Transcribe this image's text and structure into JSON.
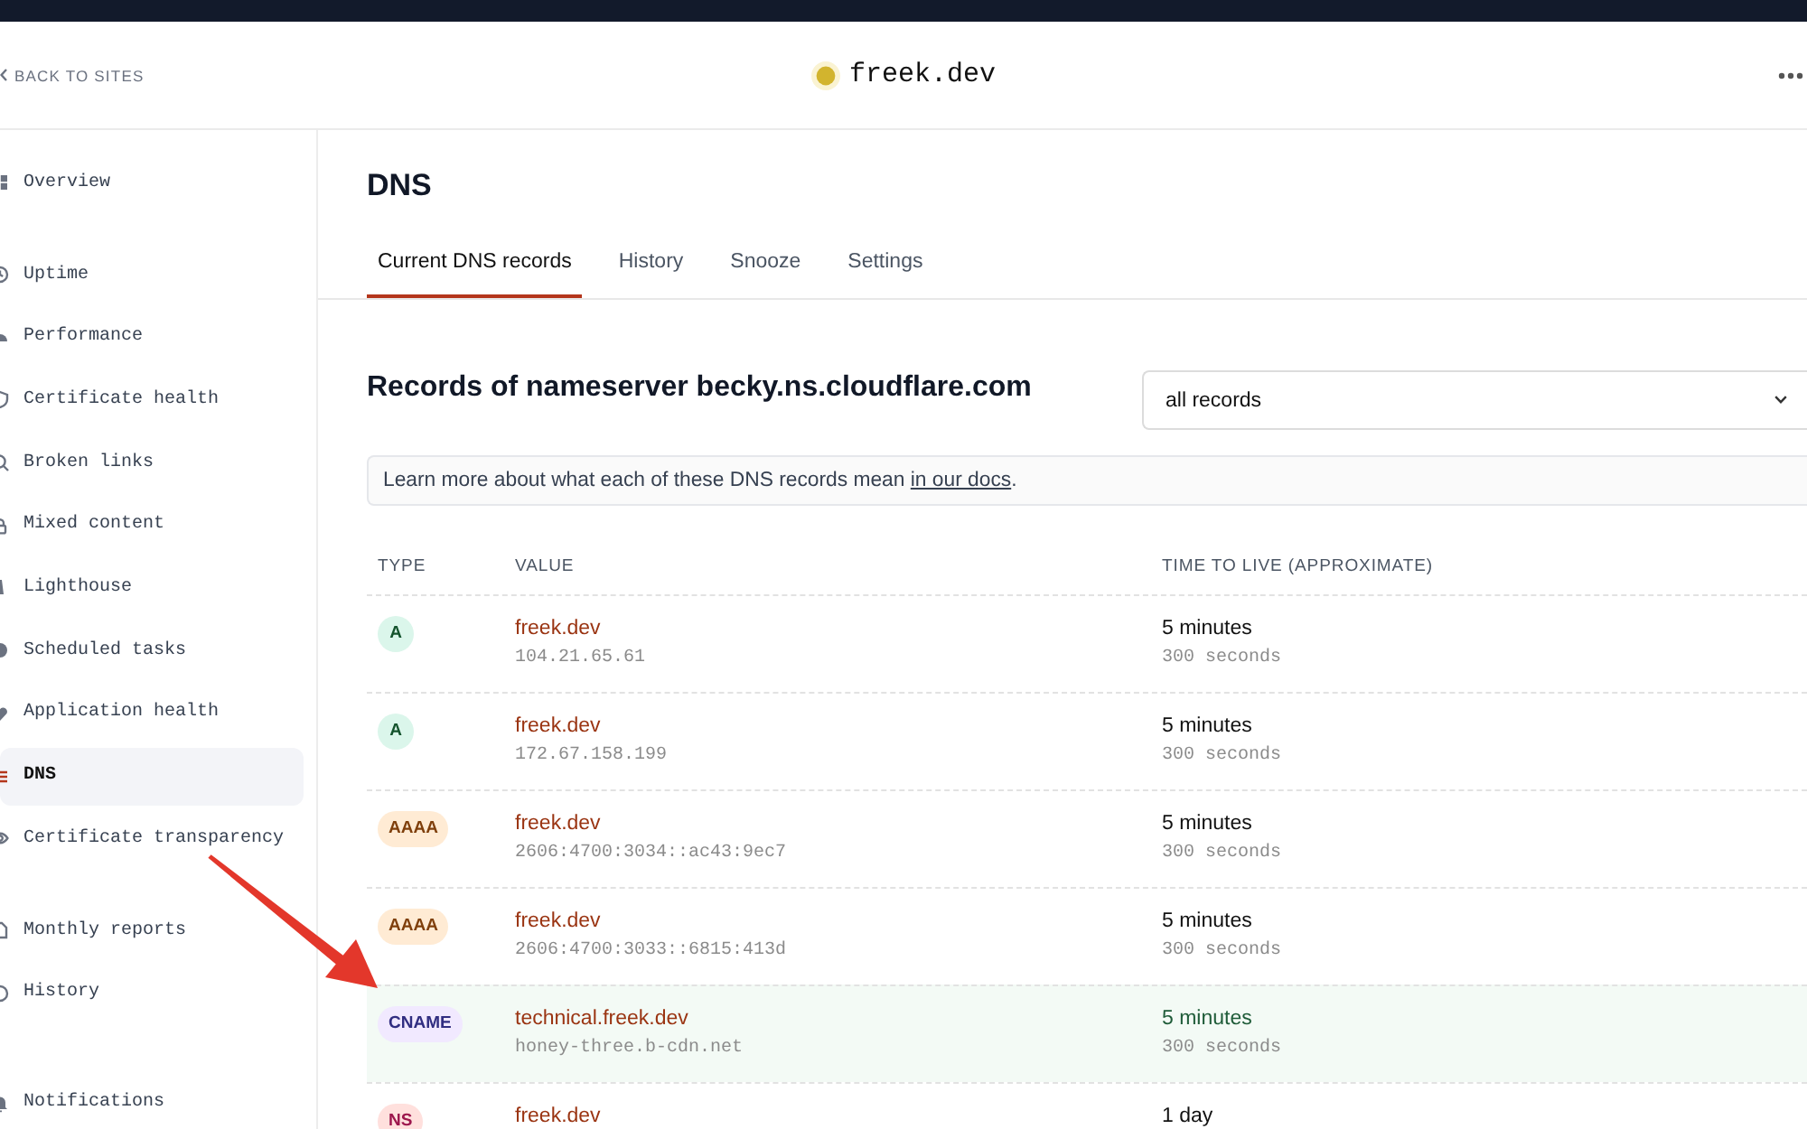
{
  "header": {
    "back_link": "BACK TO SITES",
    "site": "freek.dev"
  },
  "sidebar": {
    "groups": [
      {
        "items": [
          {
            "label": "Overview",
            "selected": false
          }
        ]
      },
      {
        "items": [
          {
            "label": "Uptime",
            "selected": false
          },
          {
            "label": "Performance",
            "selected": false
          },
          {
            "label": "Certificate health",
            "selected": false
          },
          {
            "label": "Broken links",
            "selected": false
          },
          {
            "label": "Mixed content",
            "selected": false
          },
          {
            "label": "Lighthouse",
            "selected": false
          },
          {
            "label": "Scheduled tasks",
            "selected": false
          },
          {
            "label": "Application health",
            "selected": false
          },
          {
            "label": "DNS",
            "selected": true
          },
          {
            "label": "Certificate transparency",
            "selected": false
          }
        ]
      },
      {
        "items": [
          {
            "label": "Monthly reports",
            "selected": false
          },
          {
            "label": "History",
            "selected": false
          }
        ]
      },
      {
        "items": [
          {
            "label": "Notifications",
            "selected": false
          }
        ]
      }
    ]
  },
  "main": {
    "title": "DNS",
    "tabs": [
      {
        "label": "Current DNS records",
        "selected": true
      },
      {
        "label": "History",
        "selected": false
      },
      {
        "label": "Snooze",
        "selected": false
      },
      {
        "label": "Settings",
        "selected": false
      }
    ],
    "records_title": "Records of nameserver becky.ns.cloudflare.com",
    "filter": {
      "value": "all records"
    },
    "notice": {
      "text": "Learn more about what each of these DNS records mean ",
      "link": "in our docs",
      "end": "."
    },
    "table": {
      "columns": [
        "TYPE",
        "VALUE",
        "TIME TO LIVE (APPROXIMATE)"
      ],
      "rows": [
        {
          "type": "A",
          "color": "#14532d",
          "host": "freek.dev",
          "target": "104.21.65.61",
          "ttl": "5 minutes",
          "seconds": "300 seconds",
          "highlighted": false
        },
        {
          "type": "A",
          "color": "#14532d",
          "host": "freek.dev",
          "target": "172.67.158.199",
          "ttl": "5 minutes",
          "seconds": "300 seconds",
          "highlighted": false
        },
        {
          "type": "AAAA",
          "color": "#7f3f0b",
          "host": "freek.dev",
          "target": "2606:4700:3034::ac43:9ec7",
          "ttl": "5 minutes",
          "seconds": "300 seconds",
          "highlighted": false
        },
        {
          "type": "AAAA",
          "color": "#7f3f0b",
          "host": "freek.dev",
          "target": "2606:4700:3033::6815:413d",
          "ttl": "5 minutes",
          "seconds": "300 seconds",
          "highlighted": false
        },
        {
          "type": "CNAME",
          "color": "#312e81",
          "host": "technical.freek.dev",
          "target": "honey-three.b-cdn.net",
          "ttl": "5 minutes",
          "seconds": "300 seconds",
          "highlighted": true
        },
        {
          "type": "NS",
          "color": "#9d174d",
          "host": "freek.dev",
          "ttl": "1 day",
          "highlighted": false
        }
      ]
    }
  }
}
